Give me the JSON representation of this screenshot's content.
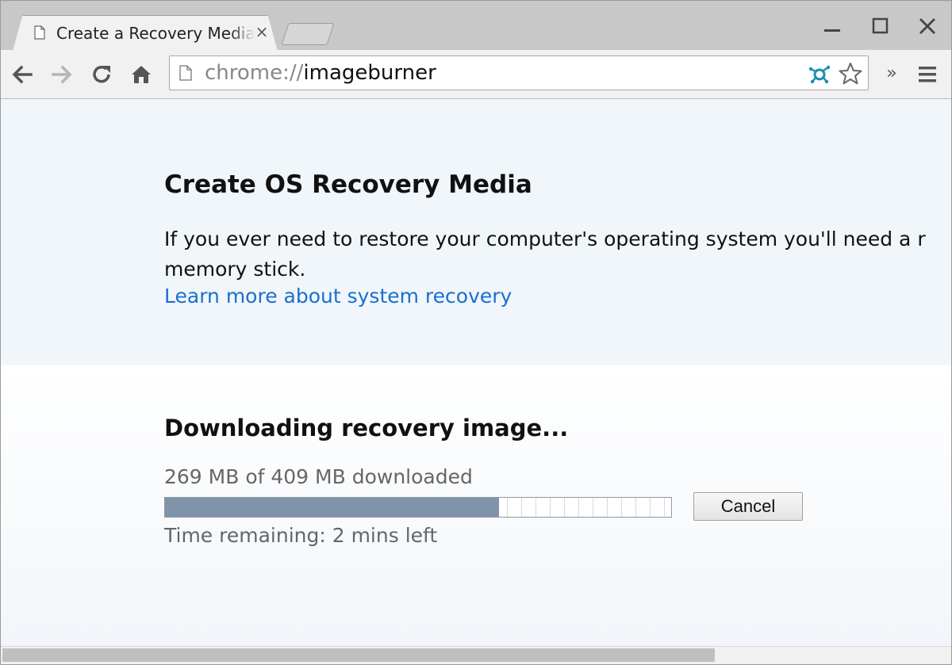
{
  "browser": {
    "tab": {
      "title": "Create a Recovery Media",
      "close_glyph": "×"
    },
    "window_controls": [
      "minimize-icon",
      "maximize-icon",
      "close-icon"
    ],
    "toolbar": {
      "icons": [
        "back-arrow-icon",
        "forward-arrow-icon",
        "reload-icon",
        "home-icon"
      ],
      "omnibox": {
        "scheme": "chrome://",
        "host": "imageburner"
      },
      "omnibox_icons": [
        "extension-icon",
        "bookmark-star-icon"
      ],
      "overflow_glyph": "»",
      "menu_icon": "hamburger-menu-icon"
    }
  },
  "page": {
    "intro": {
      "heading": "Create OS Recovery Media",
      "text_line1": "If you ever need to restore your computer's operating system you'll need a r",
      "text_line2": "memory stick.",
      "link": "Learn more about system recovery"
    },
    "progress": {
      "heading": "Downloading recovery image...",
      "status": "269 MB of 409 MB downloaded",
      "fraction": 0.66,
      "cancel_label": "Cancel",
      "time_remaining": "Time remaining: 2 mins left"
    }
  },
  "colors": {
    "link": "#1a6fcf",
    "progress_fill": "#7f94a9",
    "extension_icon": "#1a8fb0"
  }
}
